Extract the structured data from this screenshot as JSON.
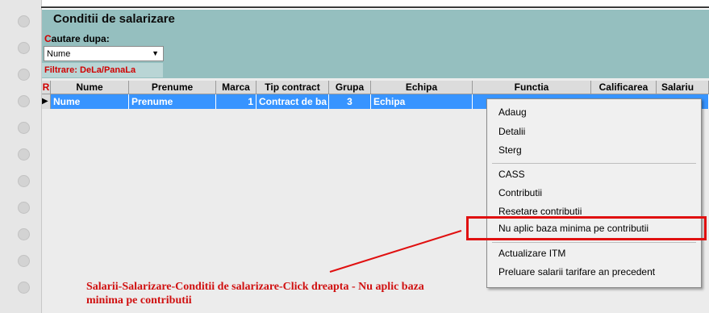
{
  "window": {
    "title": "Conditii de salarizare"
  },
  "search": {
    "label_first": "C",
    "label_rest": "autare dupa:",
    "selected": "Nume",
    "filter": "Filtrare: DeLa/PanaLa"
  },
  "grid": {
    "headers": {
      "r": "R",
      "nume": "Nume",
      "prenume": "Prenume",
      "marca": "Marca",
      "tip_contract": "Tip contract",
      "grupa": "Grupa",
      "echipa": "Echipa",
      "functia": "Functia",
      "calificarea": "Calificarea",
      "salariu": "Salariu"
    },
    "row": {
      "nume": "Nume",
      "prenume": "Prenume",
      "marca": "1",
      "tip_contract": "Contract de ba",
      "grupa": "3",
      "echipa": "Echipa"
    }
  },
  "context_menu": {
    "adaug": "Adaug",
    "detalii": "Detalii",
    "sterg": "Sterg",
    "cass": "CASS",
    "contributii": "Contributii",
    "resetare": "Resetare contributii",
    "nu_aplic": "Nu aplic baza minima pe contributii",
    "actualizare": "Actualizare ITM",
    "preluare": "Preluare salarii tarifare an precedent"
  },
  "annotation": {
    "text": "Salarii-Salarizare-Conditii de salarizare-Click dreapta - Nu aplic baza minima pe contributii"
  },
  "colors": {
    "panel": "#95bfbf",
    "selection": "#3794ff",
    "highlight": "#e01010"
  }
}
